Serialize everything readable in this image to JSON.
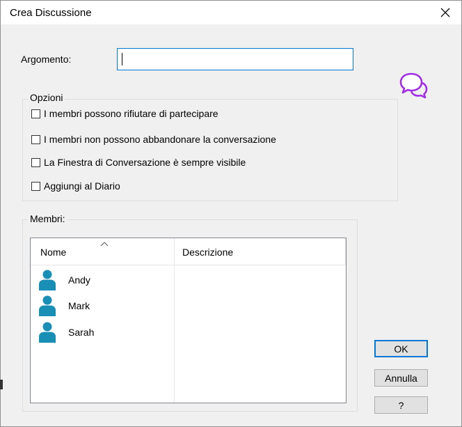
{
  "dialog": {
    "title": "Crea Discussione",
    "close_icon": "close-icon"
  },
  "subject": {
    "label": "Argomento:",
    "value": ""
  },
  "options": {
    "legend": "Opzioni",
    "items": [
      {
        "label": "I membri possono rifiutare di partecipare",
        "checked": false
      },
      {
        "label": "I membri non possono abbandonare la conversazione",
        "checked": false
      },
      {
        "label": "La Finestra di Conversazione è sempre visibile",
        "checked": false
      },
      {
        "label": "Aggiungi al Diario",
        "checked": false
      }
    ]
  },
  "members": {
    "legend": "Membri:",
    "columns": [
      "Nome",
      "Descrizione"
    ],
    "rows": [
      {
        "name": "Andy",
        "description": "",
        "icon": "user-icon"
      },
      {
        "name": "Mark",
        "description": "",
        "icon": "user-icon"
      },
      {
        "name": "Sarah",
        "description": "",
        "icon": "user-icon"
      }
    ]
  },
  "buttons": {
    "ok": "OK",
    "cancel": "Annulla",
    "help": "?"
  },
  "colors": {
    "accent": "#0078d7",
    "chat_icon": "#a12ee6",
    "user_icon": "#1a8fb5"
  }
}
